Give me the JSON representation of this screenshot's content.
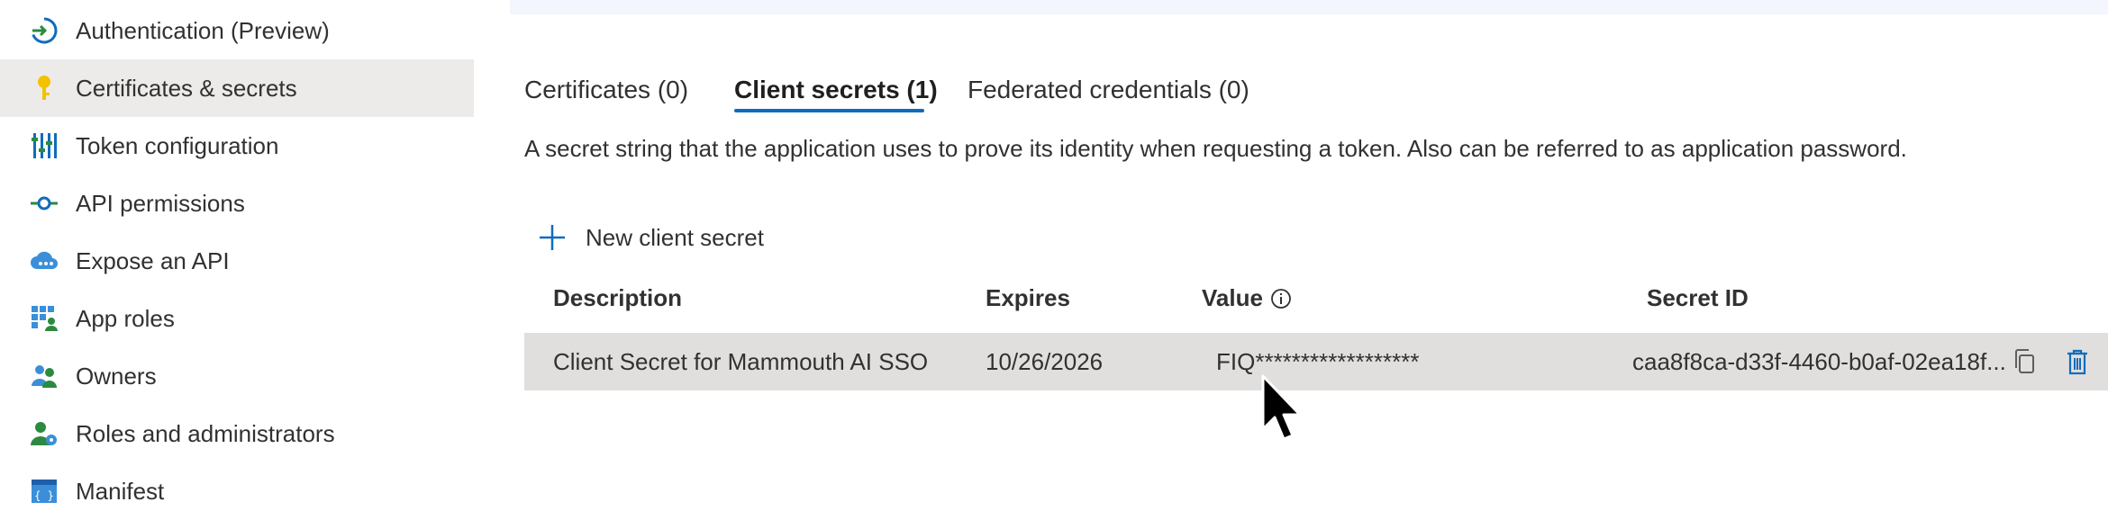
{
  "sidebar": {
    "items": [
      {
        "label": "Authentication (Preview)",
        "icon": "authentication-icon"
      },
      {
        "label": "Certificates & secrets",
        "icon": "key-icon",
        "active": true
      },
      {
        "label": "Token configuration",
        "icon": "token-config-icon"
      },
      {
        "label": "API permissions",
        "icon": "api-permissions-icon"
      },
      {
        "label": "Expose an API",
        "icon": "cloud-api-icon"
      },
      {
        "label": "App roles",
        "icon": "app-roles-icon"
      },
      {
        "label": "Owners",
        "icon": "owners-icon"
      },
      {
        "label": "Roles and administrators",
        "icon": "roles-admin-icon"
      },
      {
        "label": "Manifest",
        "icon": "manifest-icon"
      }
    ]
  },
  "tabs": [
    {
      "label": "Certificates (0)"
    },
    {
      "label": "Client secrets (1)",
      "active": true
    },
    {
      "label": "Federated credentials (0)"
    }
  ],
  "description": "A secret string that the application uses to prove its identity when requesting a token. Also can be referred to as application password.",
  "toolbar": {
    "new_secret_label": "New client secret"
  },
  "table": {
    "headers": {
      "description": "Description",
      "expires": "Expires",
      "value": "Value",
      "secret_id": "Secret ID"
    },
    "rows": [
      {
        "description": "Client Secret for Mammouth AI SSO",
        "expires": "10/26/2026",
        "value": "FIQ******************",
        "secret_id": "caa8f8ca-d33f-4460-b0af-02ea18f..."
      }
    ]
  },
  "colors": {
    "accent": "#0f6cbd",
    "selected_row": "#e1dfdd",
    "active_nav": "#edebe9"
  }
}
